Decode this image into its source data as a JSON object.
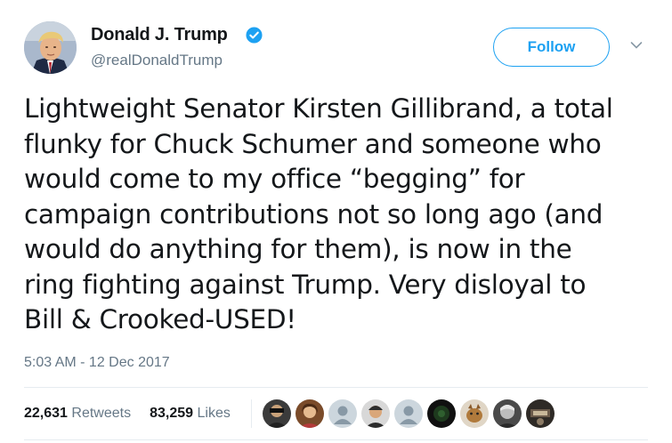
{
  "author": {
    "name": "Donald J. Trump",
    "handle": "@realDonaldTrump",
    "verified": true
  },
  "follow_label": "Follow",
  "tweet": {
    "text": "Lightweight Senator Kirsten Gillibrand, a total\nflunky for Chuck Schumer and someone who\nwould come to my office “begging” for\ncampaign contributions not so long ago (and\nwould do anything for them), is now in the\nring fighting against Trump. Very disloyal to\nBill & Crooked-USED!",
    "timestamp": "5:03 AM - 12 Dec 2017"
  },
  "stats": {
    "retweets_count": "22,631",
    "retweets_label": "Retweets",
    "likes_count": "83,259",
    "likes_label": "Likes"
  },
  "colors": {
    "accent": "#1da1f2",
    "text": "#14171a",
    "secondary": "#657786",
    "divider": "#e6ecf0"
  },
  "liker_avatars": [
    "avatar-photo",
    "avatar-photo",
    "default-egg-avatar",
    "avatar-photo",
    "default-egg-avatar",
    "avatar-photo",
    "avatar-photo",
    "avatar-photo",
    "avatar-photo"
  ]
}
